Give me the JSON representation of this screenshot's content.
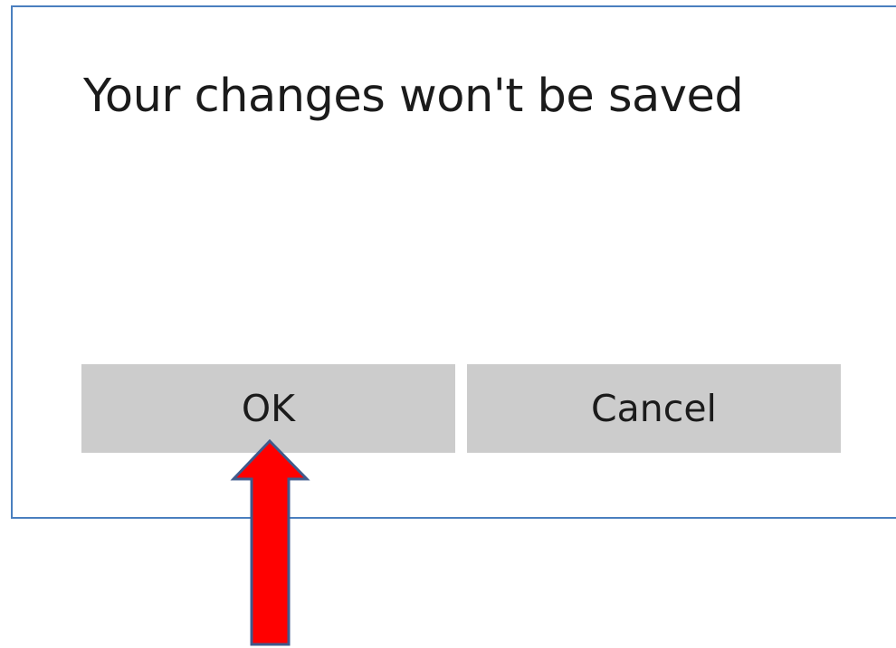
{
  "dialog": {
    "message": "Your changes won't be saved",
    "ok_label": "OK",
    "cancel_label": "Cancel"
  },
  "annotation": {
    "icon": "red-up-arrow-icon",
    "points_to": "ok-button",
    "fill_color": "#ff0000",
    "stroke_color": "#3f5a8c"
  },
  "colors": {
    "dialog_border": "#4a7fbf",
    "button_background": "#cccccc",
    "text": "#1b1b1b"
  }
}
